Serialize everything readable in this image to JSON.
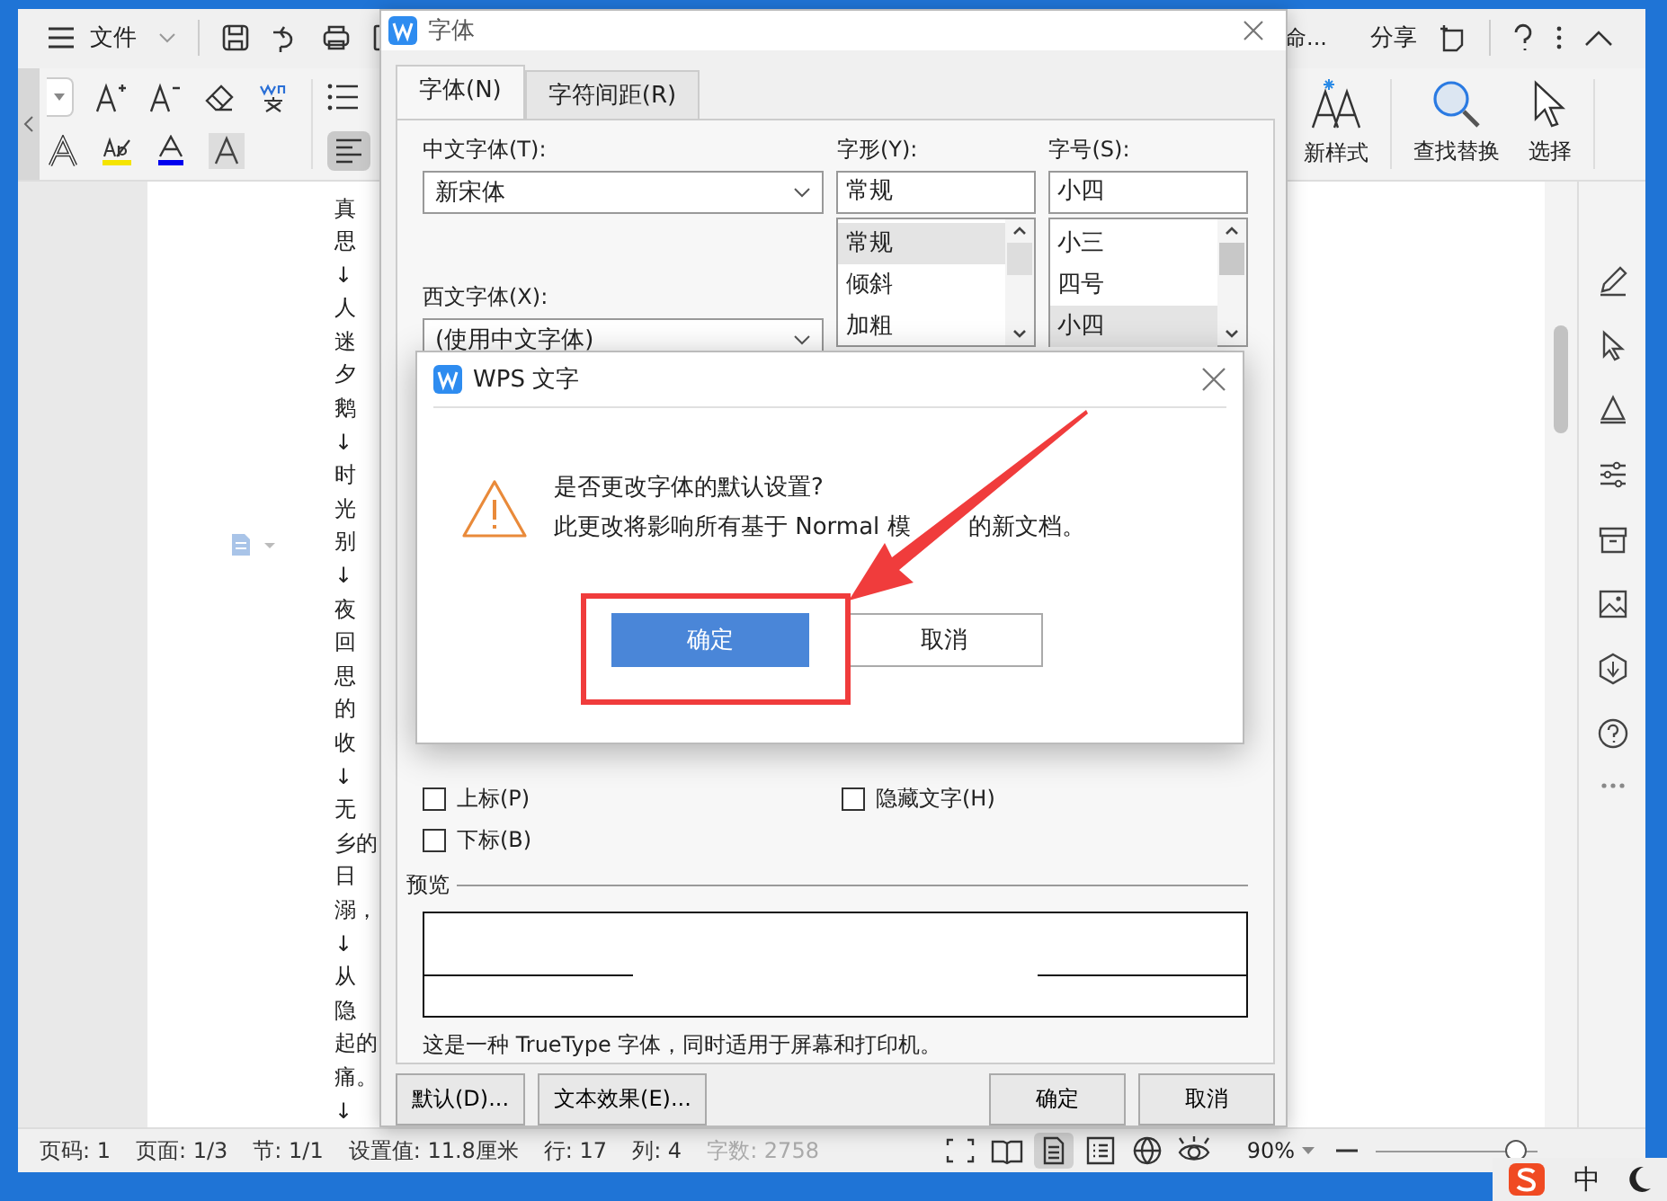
{
  "toolbar": {
    "file_menu": "文件",
    "partial_tab": "命...",
    "share": "分享"
  },
  "ribbon": {
    "align_left": {
      "selected": true
    },
    "new_style": "新样式",
    "find_replace": "查找替换",
    "select": "选择"
  },
  "document": {
    "lines": [
      "真",
      "思",
      "↓",
      "人",
      "迷",
      "夕",
      "鹅",
      "↓",
      "时",
      "光",
      "别",
      "↓",
      "夜",
      "回",
      "思",
      "的",
      "收",
      "↓",
      "无",
      "乡的",
      "日",
      "溺，",
      "↓",
      "从",
      "隐",
      "起的",
      "痛。",
      "↓"
    ]
  },
  "font_dialog": {
    "title": "字体",
    "tabs": [
      {
        "label": "字体(N)",
        "selected": true
      },
      {
        "label": "字符间距(R)",
        "selected": false
      }
    ],
    "chinese_font_label": "中文字体(T):",
    "chinese_font": "新宋体",
    "western_font_label": "西文字体(X):",
    "western_font": "(使用中文字体)",
    "style_label": "字形(Y):",
    "style_value": "常规",
    "style_options": [
      {
        "label": "常规",
        "selected": true
      },
      {
        "label": "倾斜",
        "selected": false
      },
      {
        "label": "加粗",
        "selected": false
      }
    ],
    "size_label": "字号(S):",
    "size_value": "小四",
    "size_options": [
      {
        "label": "小三",
        "selected": false
      },
      {
        "label": "四号",
        "selected": false
      },
      {
        "label": "小四",
        "selected": true
      }
    ],
    "checkboxes": [
      {
        "label": "上标(P)",
        "checked": false
      },
      {
        "label": "隐藏文字(H)",
        "checked": false
      },
      {
        "label": "下标(B)",
        "checked": false
      }
    ],
    "preview_label": "预览",
    "preview_note": "这是一种 TrueType 字体，同时适用于屏幕和打印机。",
    "left_buttons": [
      "默认(D)...",
      "文本效果(E)..."
    ],
    "ok": "确定",
    "cancel": "取消"
  },
  "confirm_dialog": {
    "title": "WPS 文字",
    "question": "是否更改字体的默认设置?",
    "notice_parts": [
      "此更改将影响所有基于 Normal 模",
      "的新文档。"
    ],
    "buttons": [
      {
        "label": "确定",
        "primary": true
      },
      {
        "label": "取消",
        "primary": false
      }
    ]
  },
  "status_bar": {
    "items": [
      {
        "text": "页码: 1",
        "disabled": false
      },
      {
        "text": "页面: 1/3",
        "disabled": false
      },
      {
        "text": "节: 1/1",
        "disabled": false
      },
      {
        "text": "设置值: 11.8厘米",
        "disabled": false
      },
      {
        "text": "行: 17",
        "disabled": false
      },
      {
        "text": "列: 4",
        "disabled": false
      },
      {
        "text": "字数: 2758",
        "disabled": true
      }
    ],
    "view_buttons": [
      {
        "selected": false
      },
      {
        "selected": false
      },
      {
        "selected": true
      },
      {
        "selected": false
      },
      {
        "selected": false
      },
      {
        "selected": false
      }
    ],
    "zoom": "90%",
    "zoom_slider": {
      "level": 0.85
    }
  },
  "tray": {
    "ime": "中"
  }
}
